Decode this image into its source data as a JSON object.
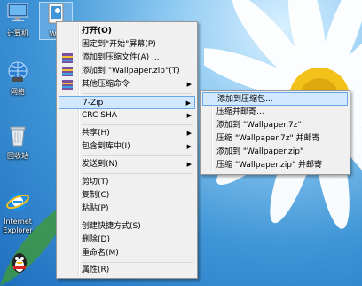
{
  "desktop": {
    "icons": [
      {
        "label": "计算机",
        "name": "computer"
      },
      {
        "label": "Wal",
        "name": "wallpaper-file"
      },
      {
        "label": "网络",
        "name": "network"
      },
      {
        "label": "回收站",
        "name": "recycle-bin"
      },
      {
        "label": "Internet\nExplorer",
        "name": "internet-explorer"
      }
    ]
  },
  "context_menu": {
    "items": [
      {
        "label": "打开(O)",
        "bold": true
      },
      {
        "label": "固定到\"开始\"屏幕(P)"
      },
      {
        "label": "添加到压缩文件(A) ..."
      },
      {
        "label": "添加到 \"Wallpaper.zip\"(T)"
      },
      {
        "label": "其他压缩命令"
      },
      {
        "label": "7-Zip"
      },
      {
        "label": "CRC SHA"
      },
      {
        "label": "共享(H)"
      },
      {
        "label": "包含到库中(I)"
      },
      {
        "label": "发送到(N)"
      },
      {
        "label": "剪切(T)"
      },
      {
        "label": "复制(C)"
      },
      {
        "label": "粘贴(P)"
      },
      {
        "label": "创建快捷方式(S)"
      },
      {
        "label": "删除(D)"
      },
      {
        "label": "重命名(M)"
      },
      {
        "label": "属性(R)"
      }
    ]
  },
  "submenu_7zip": {
    "items": [
      {
        "label": "添加到压缩包..."
      },
      {
        "label": "压缩并邮寄..."
      },
      {
        "label": "添加到 \"Wallpaper.7z\""
      },
      {
        "label": "压缩 \"Wallpaper.7z\" 并邮寄"
      },
      {
        "label": "添加到 \"Wallpaper.zip\""
      },
      {
        "label": "压缩 \"Wallpaper.zip\" 并邮寄"
      }
    ]
  }
}
